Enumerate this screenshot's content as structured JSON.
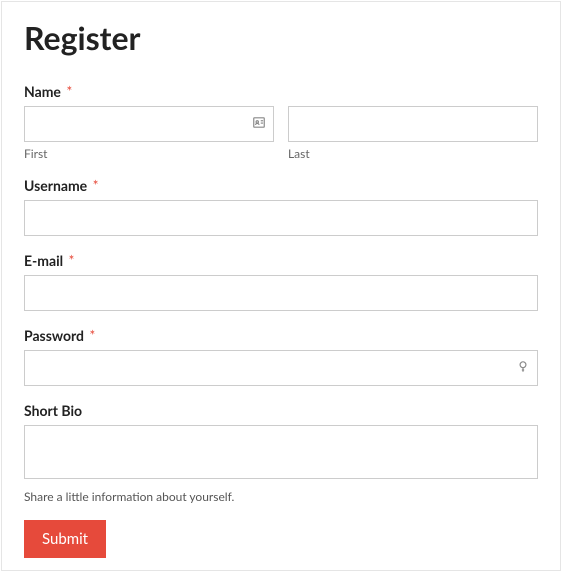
{
  "title": "Register",
  "fields": {
    "name": {
      "label": "Name",
      "required": "*",
      "first": {
        "value": "",
        "sublabel": "First"
      },
      "last": {
        "value": "",
        "sublabel": "Last"
      }
    },
    "username": {
      "label": "Username",
      "required": "*",
      "value": ""
    },
    "email": {
      "label": "E-mail",
      "required": "*",
      "value": ""
    },
    "password": {
      "label": "Password",
      "required": "*",
      "value": ""
    },
    "bio": {
      "label": "Short Bio",
      "value": "",
      "helper": "Share a little information about yourself."
    }
  },
  "submit": {
    "label": "Submit"
  }
}
